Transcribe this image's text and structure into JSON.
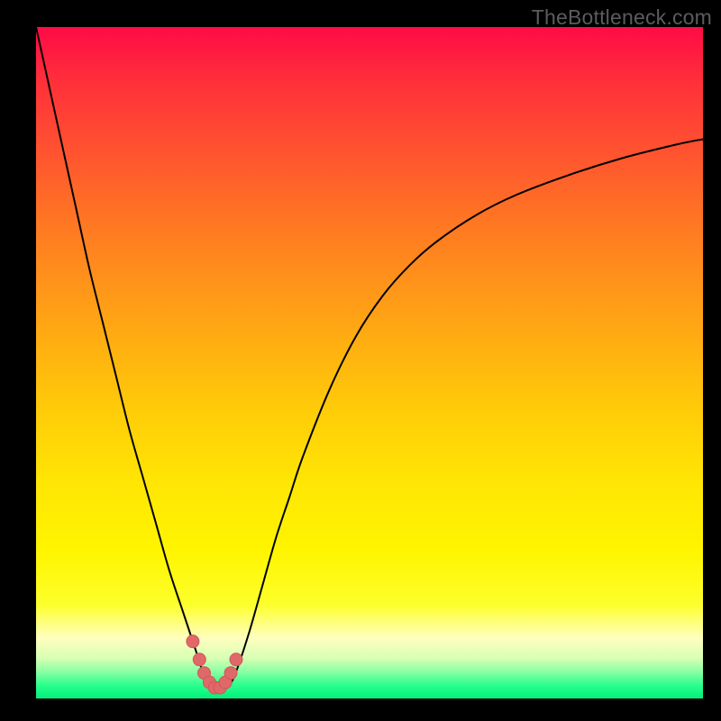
{
  "watermark": "TheBottleneck.com",
  "colors": {
    "background_top": "#ff0b46",
    "background_bottom": "#00f07a",
    "curve": "#000000",
    "dot_fill": "#e16868",
    "dot_stroke": "#d05858"
  },
  "chart_data": {
    "type": "line",
    "title": "",
    "xlabel": "",
    "ylabel": "",
    "xlim": [
      0,
      100
    ],
    "ylim": [
      0,
      100
    ],
    "grid": false,
    "series": [
      {
        "name": "bottleneck",
        "x": [
          0,
          2,
          4,
          6,
          8,
          10,
          12,
          14,
          16,
          18,
          20,
          22,
          23,
          24,
          25,
          26,
          27,
          28,
          29,
          30,
          32,
          34,
          36,
          38,
          40,
          44,
          48,
          52,
          56,
          60,
          66,
          72,
          80,
          88,
          96,
          100
        ],
        "y": [
          100,
          91,
          82,
          73,
          64,
          56,
          48,
          40,
          33,
          26,
          19,
          13,
          10,
          7,
          4,
          2,
          1.2,
          1.2,
          2,
          4,
          10,
          17,
          24,
          30,
          36,
          46,
          54,
          60,
          64.5,
          68,
          72,
          75,
          78,
          80.5,
          82.5,
          83.3
        ]
      }
    ],
    "annotations": [],
    "min_region_dots_x": [
      23.5,
      24.5,
      25.2,
      26.0,
      26.8,
      27.6,
      28.4,
      29.2,
      30.0
    ],
    "min_region_dots_y": [
      8.5,
      5.8,
      3.8,
      2.4,
      1.6,
      1.6,
      2.4,
      3.8,
      5.8
    ]
  }
}
